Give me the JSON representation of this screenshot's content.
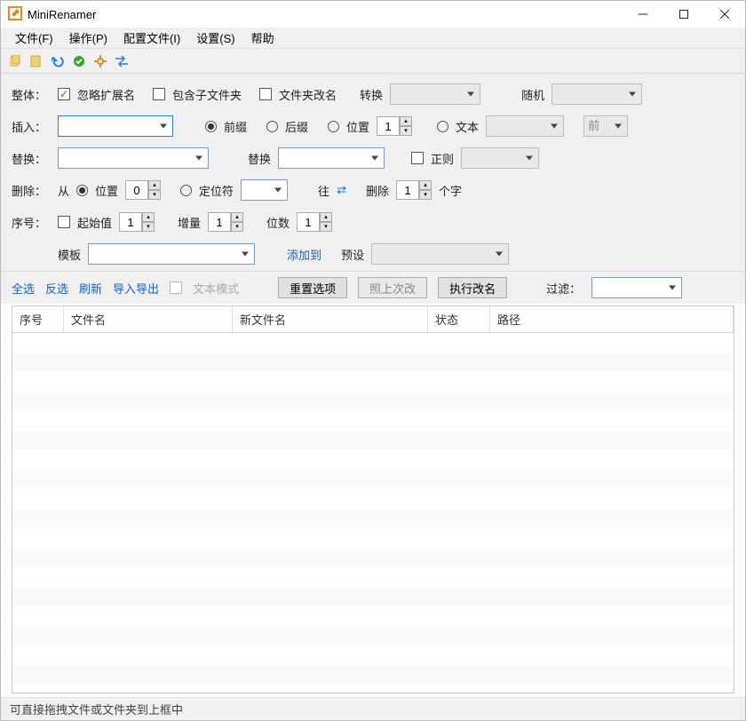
{
  "title": "MiniRenamer",
  "menus": {
    "file": "文件(F)",
    "operate": "操作(P)",
    "config": "配置文件(I)",
    "settings": "设置(S)",
    "help": "帮助"
  },
  "global": {
    "label": "整体：",
    "ignoreExt": "忽略扩展名",
    "includeSub": "包含子文件夹",
    "renameFolder": "文件夹改名",
    "convert": "转换",
    "random": "随机"
  },
  "insert": {
    "label": "插入：",
    "prefix": "前缀",
    "suffix": "后缀",
    "position": "位置",
    "posVal": "1",
    "text": "文本",
    "front": "前"
  },
  "replace": {
    "label": "替换：",
    "replaceWord": "替换",
    "regex": "正则"
  },
  "remove": {
    "label": "删除：",
    "from": "从",
    "position": "位置",
    "posVal": "0",
    "locator": "定位符",
    "to": "往",
    "removeN": "删除",
    "nVal": "1",
    "chars": "个字"
  },
  "seq": {
    "label": "序号：",
    "start": "起始值",
    "startVal": "1",
    "step": "增量",
    "stepVal": "1",
    "digits": "位数",
    "digitsVal": "1",
    "template": "模板",
    "addTo": "添加到",
    "preset": "预设"
  },
  "actions": {
    "selectAll": "全选",
    "invert": "反选",
    "refresh": "刷新",
    "importExport": "导入导出",
    "textMode": "文本模式",
    "reset": "重置选项",
    "repeatLast": "照上次改",
    "execute": "执行改名",
    "filter": "过滤："
  },
  "columns": {
    "index": "序号",
    "filename": "文件名",
    "newname": "新文件名",
    "status": "状态",
    "path": "路径"
  },
  "statusText": "可直接拖拽文件或文件夹到上框中"
}
